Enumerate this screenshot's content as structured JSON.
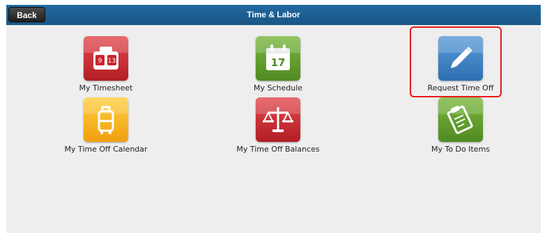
{
  "header": {
    "back_label": "Back",
    "title": "Time & Labor"
  },
  "tiles": [
    {
      "label": "My Timesheet",
      "icon": "timesheet-icon",
      "color": "#c8262c"
    },
    {
      "label": "My Schedule",
      "icon": "calendar-icon",
      "color": "#5e9a2e"
    },
    {
      "label": "Request Time Off",
      "icon": "pencil-icon",
      "color": "#3a7fc1"
    },
    {
      "label": "My Time Off Calendar",
      "icon": "luggage-icon",
      "color": "#f3a51b"
    },
    {
      "label": "My Time Off Balances",
      "icon": "scales-icon",
      "color": "#c8262c"
    },
    {
      "label": "My To Do Items",
      "icon": "clipboard-icon",
      "color": "#5e9a2e"
    }
  ],
  "calendar_day": "17",
  "annotation": {
    "color": "#e61919"
  }
}
